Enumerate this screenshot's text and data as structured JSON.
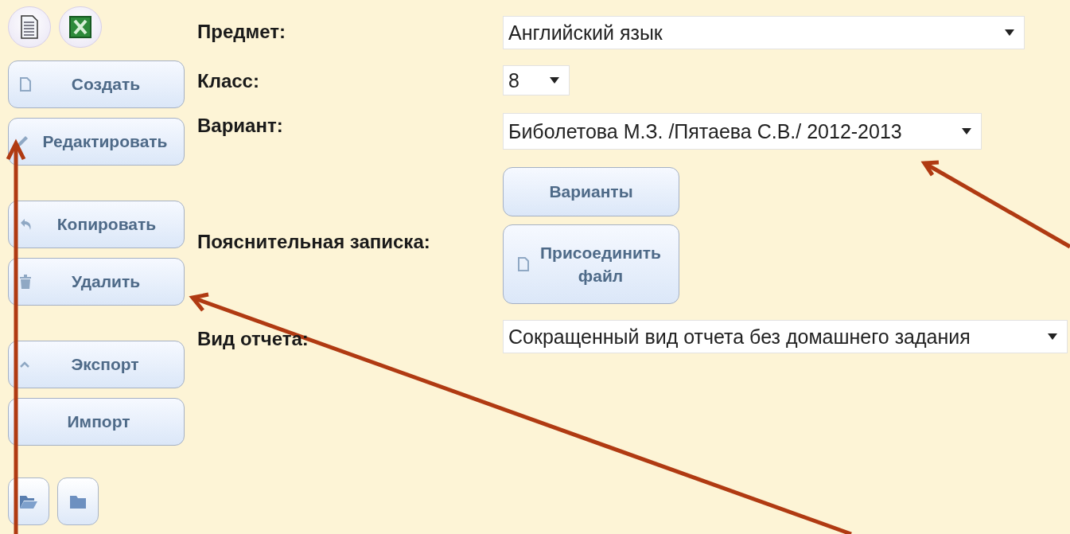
{
  "sidebar": {
    "top_icons": [
      {
        "kind": "document"
      },
      {
        "kind": "spreadsheet"
      }
    ],
    "groups": [
      [
        {
          "label": "Создать",
          "kind": "document"
        },
        {
          "label": "Редактировать",
          "kind": "pencil"
        }
      ],
      [
        {
          "label": "Копировать",
          "kind": "undo"
        },
        {
          "label": "Удалить",
          "kind": "trash"
        }
      ],
      [
        {
          "label": "Экспорт",
          "kind": "caret"
        },
        {
          "label": "Импорт",
          "kind": "plain"
        }
      ]
    ],
    "bottom_icons": [
      {
        "kind": "folder-open"
      },
      {
        "kind": "folder"
      }
    ]
  },
  "form": {
    "subject": {
      "label": "Предмет:",
      "value": "Английский язык"
    },
    "grade": {
      "label": "Класс:",
      "value": "8"
    },
    "variant": {
      "label": "Вариант:",
      "value": "Биболетова М.З. /Пятаева С.В./ 2012-2013"
    },
    "variants_button": "Варианты",
    "note": {
      "label": "Пояснительная записка:",
      "button": "Присоединить файл"
    },
    "report": {
      "label": "Вид отчета:",
      "value": "Сокращенный вид отчета без домашнего задания"
    }
  }
}
